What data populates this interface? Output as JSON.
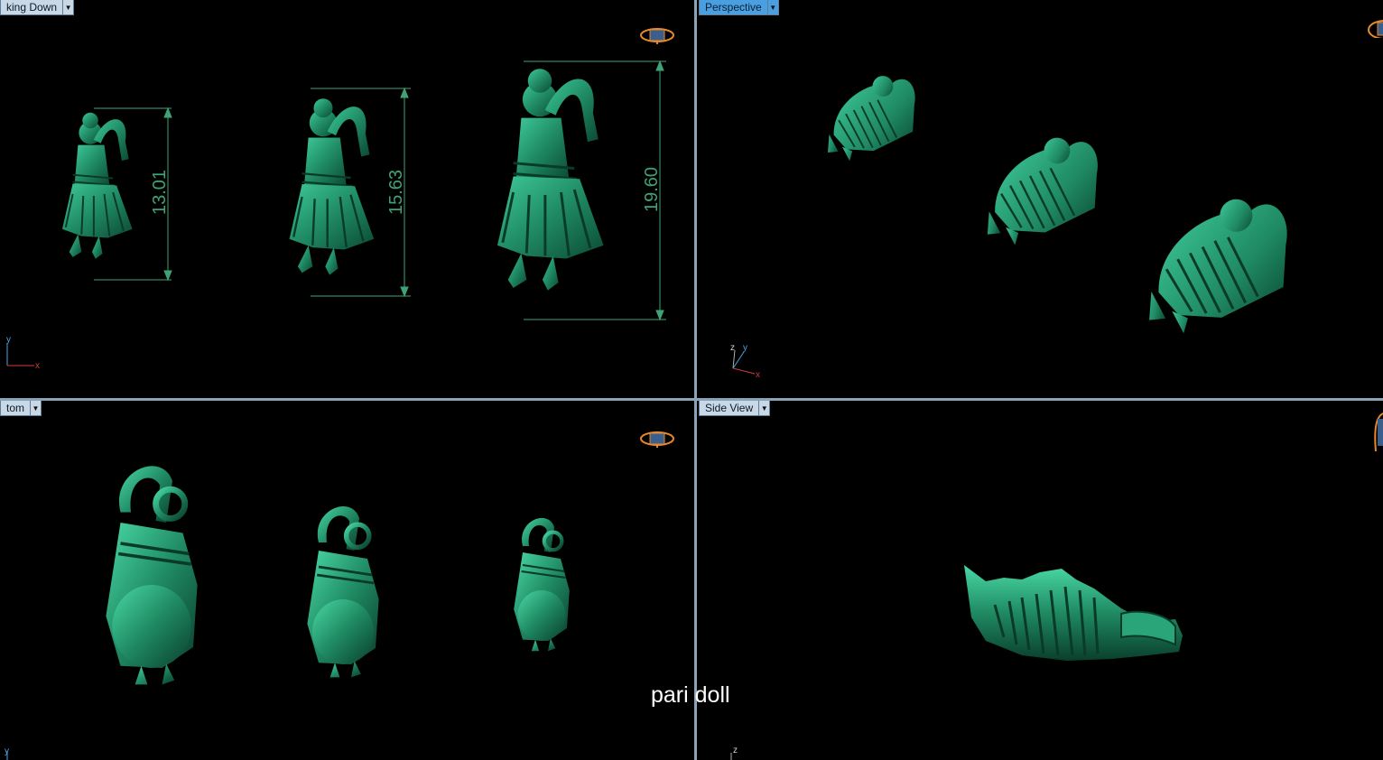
{
  "viewports": {
    "top": {
      "label": "king Down",
      "dimensions": [
        "13.01",
        "15.63",
        "19.60"
      ],
      "axes": [
        "y",
        "x"
      ]
    },
    "perspective": {
      "label": "Perspective",
      "axes": [
        "z",
        "y",
        "x"
      ]
    },
    "bottom": {
      "label": "tom",
      "axes": [
        "y"
      ]
    },
    "side": {
      "label": "Side View",
      "axes": [
        "z"
      ]
    }
  },
  "caption": "pari doll",
  "icons": {
    "dropdown": "chevron-down-icon",
    "navigation": "navigation-cube-icon",
    "model": "dancer-figurine"
  },
  "colors": {
    "model": "#1f8a63",
    "dimension": "#3fa274",
    "active_tab": "#4a9fe0",
    "tab": "#c9d8e6",
    "divider": "#8aa3ba"
  }
}
